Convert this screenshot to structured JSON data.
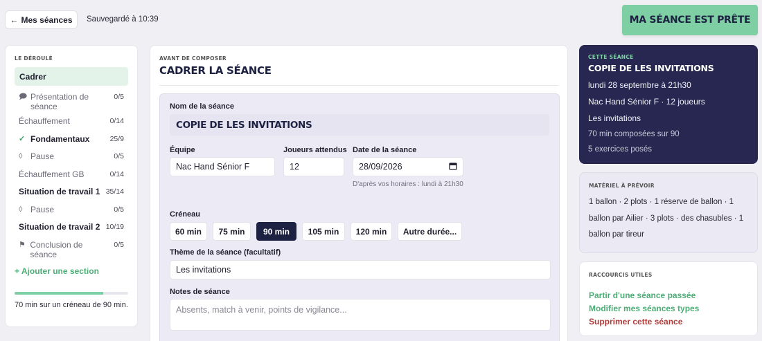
{
  "topbar": {
    "back_label": "Mes séances",
    "back_arrow": "←",
    "saved_text": "Sauvegardé à 10:39",
    "ready_label": "MA SÉANCE EST PRÊTE"
  },
  "deroule": {
    "label": "LE DÉROULÉ",
    "current": "Cadrer",
    "steps": [
      {
        "icon": "speech-bubble-icon",
        "glyph": "🗩",
        "label": "Présentation de séance",
        "count": "0/5",
        "bold": false
      },
      {
        "icon": "",
        "glyph": "",
        "label": "Échauffement",
        "count": "0/14",
        "bold": false
      },
      {
        "icon": "check-icon",
        "glyph": "✓",
        "label": "Fondamentaux",
        "count": "25/9",
        "bold": true
      },
      {
        "icon": "drop-icon",
        "glyph": "◊",
        "label": "Pause",
        "count": "0/5",
        "bold": false
      },
      {
        "icon": "",
        "glyph": "",
        "label": "Échauffement GB",
        "count": "0/14",
        "bold": false
      },
      {
        "icon": "",
        "glyph": "",
        "label": "Situation de travail 1",
        "count": "35/14",
        "bold": true
      },
      {
        "icon": "drop-icon",
        "glyph": "◊",
        "label": "Pause",
        "count": "0/5",
        "bold": false
      },
      {
        "icon": "",
        "glyph": "",
        "label": "Situation de travail 2",
        "count": "10/19",
        "bold": true
      },
      {
        "icon": "flag-icon",
        "glyph": "⚑",
        "label": "Conclusion de séance",
        "count": "0/5",
        "bold": false
      }
    ],
    "add_section": "+ Ajouter une section",
    "progress_fraction": 0.78,
    "progress_text": "70 min sur un créneau de 90 min."
  },
  "main": {
    "eyebrow": "AVANT DE COMPOSER",
    "title": "CADRER LA SÉANCE",
    "name_label": "Nom de la séance",
    "name_value": "COPIE DE LES INVITATIONS",
    "team_label": "Équipe",
    "team_value": "Nac Hand Sénior F",
    "players_label": "Joueurs attendus",
    "players_value": "12",
    "date_label": "Date de la séance",
    "date_value": "28/09/2026",
    "date_hint": "D'après vos horaires : lundi à 21h30",
    "slot_label": "Créneau",
    "slots": [
      "60 min",
      "75 min",
      "90 min",
      "105 min",
      "120 min",
      "Autre durée..."
    ],
    "slot_selected": 2,
    "theme_label": "Thème de la séance (facultatif)",
    "theme_value": "Les invitations",
    "notes_label": "Notes de séance",
    "notes_placeholder": "Absents, match à venir, points de vigilance..."
  },
  "summary": {
    "label": "CETTE SÉANCE",
    "title": "COPIE DE LES INVITATIONS",
    "date": "lundi 28 septembre à 21h30",
    "team": "Nac Hand Sénior F · 12 joueurs",
    "theme": "Les invitations",
    "composed": "70 min composées sur 90",
    "exercises": "5 exercices posés"
  },
  "materiel": {
    "label": "MATÉRIEL À PRÉVOIR",
    "text": "1 ballon · 2 plots · 1 réserve de ballon · 1 ballon par Ailier · 3 plots · des chasubles · 1 ballon par tireur"
  },
  "raccourcis": {
    "label": "RACCOURCIS UTILES",
    "links": [
      {
        "label": "Partir d'une séance passée",
        "tone": "green"
      },
      {
        "label": "Modifier mes séances types",
        "tone": "green"
      },
      {
        "label": "Supprimer cette séance",
        "tone": "red"
      }
    ]
  },
  "colors": {
    "accent_green": "#7ecfa3",
    "navy": "#1d2242",
    "danger": "#b03a3a"
  }
}
